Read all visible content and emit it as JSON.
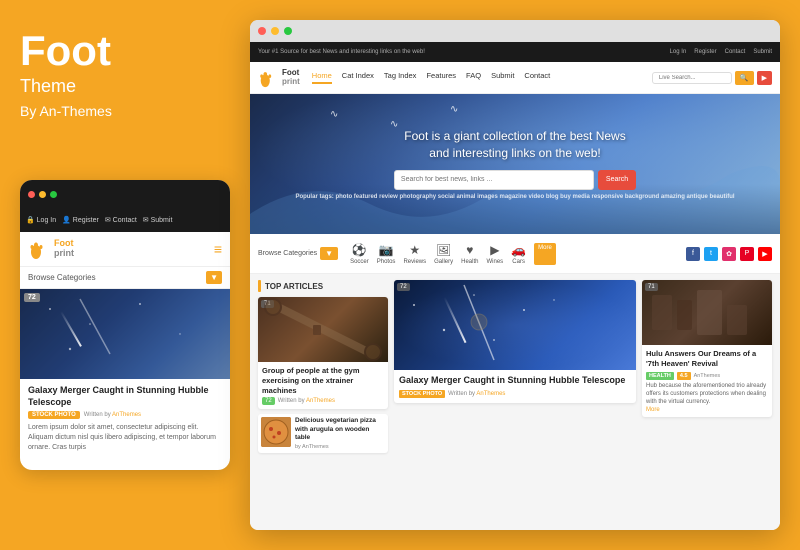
{
  "brand": {
    "title": "Foot",
    "subtitle": "Theme",
    "by": "By An-Themes"
  },
  "mobile": {
    "topbar_placeholder": "...",
    "tagline": "Your #1 Source for best News...",
    "logo_text_line1": "Foot",
    "logo_text_line2": "print",
    "browse_label": "Browse Categories",
    "article": {
      "score": "72",
      "title": "Galaxy Merger Caught in Stunning Hubble Telescope",
      "tag": "STOCK PHOTO",
      "written_by": "Written by",
      "author": "AnThemes",
      "excerpt": "Lorem ipsum dolor sit amet, consectetur adipiscing elit. Aliquam dictum nisl quis libero adipiscing, et tempor laborum ornare. Cras turpis"
    }
  },
  "desktop": {
    "topbar": {
      "tagline": "Your #1 Source for best News and interesting links on the web!",
      "login": "Log In",
      "register": "Register",
      "contact": "Contact",
      "submit": "Submit"
    },
    "nav": {
      "logo_line1": "Foot",
      "logo_line2": "print",
      "items": [
        "Home",
        "Cat Index",
        "Tag Index",
        "Features",
        "FAQ",
        "Submit",
        "Contact"
      ],
      "active_item": "Home",
      "search_placeholder": "Live Search..."
    },
    "hero": {
      "title_line1": "Foot is a giant collection of the best News",
      "title_line2": "and interesting links on the web!",
      "search_placeholder": "Search for best news, links ...",
      "search_btn": "Search",
      "popular_label": "Popular tags:",
      "tags": "photo featured review photography social animal images magazine video blog buy media responsive background amazing antique beautiful"
    },
    "categories": {
      "browse_label": "Browse Categories",
      "items": [
        "Soccer",
        "Photos",
        "Reviews",
        "Gallery",
        "Health",
        "Wines",
        "Cars"
      ],
      "more": "More"
    },
    "top_articles": {
      "section_title": "TOP ARTICLES",
      "main_article": {
        "score": "71",
        "title": "Group of people at the gym exercising on the xtrainer machines",
        "score_badge": "72",
        "written_by": "Written by",
        "author": "AnThemes"
      },
      "sub_articles": [
        {
          "title": "Delicious vegetarian pizza with arugula on wooden table",
          "meta": "by AnThemes"
        }
      ]
    },
    "middle_article": {
      "score": "72",
      "title": "Galaxy Merger Caught in Stunning Hubble Telescope",
      "tag1": "STOCK PHOTO",
      "tag2": "Written by",
      "author": "AnThemes"
    },
    "right_article": {
      "score": "71",
      "title": "Hulu Answers Our Dreams of a '7th Heaven' Revival",
      "tag1": "HEALTH",
      "tag2": "4.5",
      "by": "AnThemes",
      "excerpt": "Hub because the aforementioned trio already offers its customers protections when dealing with the virtual currency.",
      "more": "More"
    }
  }
}
